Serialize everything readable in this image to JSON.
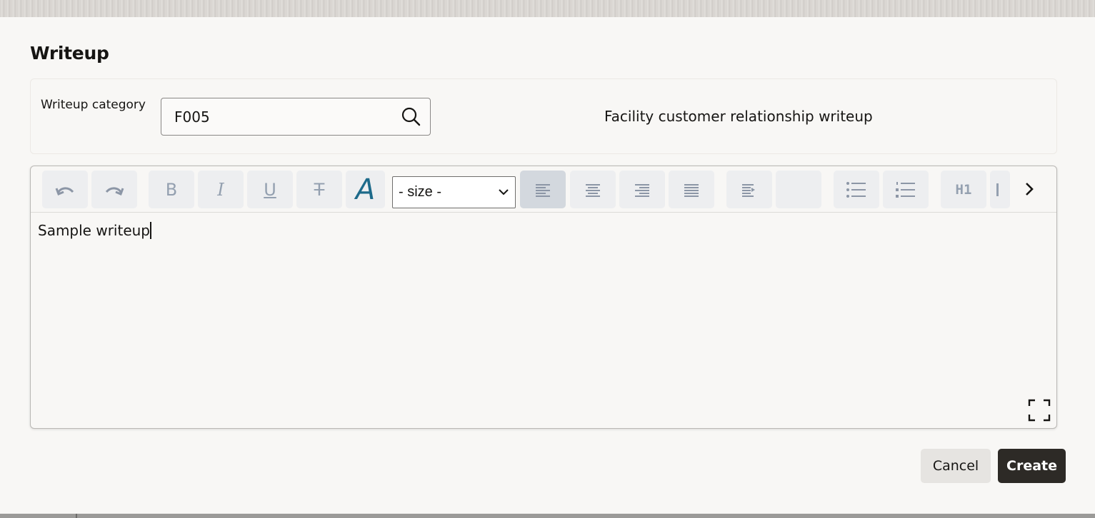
{
  "dialog": {
    "title": "Writeup",
    "category": {
      "label": "Writeup category",
      "value": "F005",
      "description": "Facility customer relationship writeup"
    },
    "editor": {
      "toolbar": {
        "undo_icon": "undo-icon",
        "redo_icon": "redo-icon",
        "bold": "B",
        "italic": "I",
        "underline": "U",
        "strike": "T",
        "font_color": "A",
        "size_select": "- size -",
        "heading": "H1"
      },
      "content": "Sample writeup"
    },
    "actions": {
      "cancel": "Cancel",
      "create": "Create"
    }
  },
  "colors": {
    "dialog_bg": "#f8f7f5",
    "toolbar_button_bg": "#edeef0",
    "toolbar_icon": "#8c96a6",
    "font_color_accent": "#1d6a8a",
    "create_button_bg": "#2d2a26"
  }
}
